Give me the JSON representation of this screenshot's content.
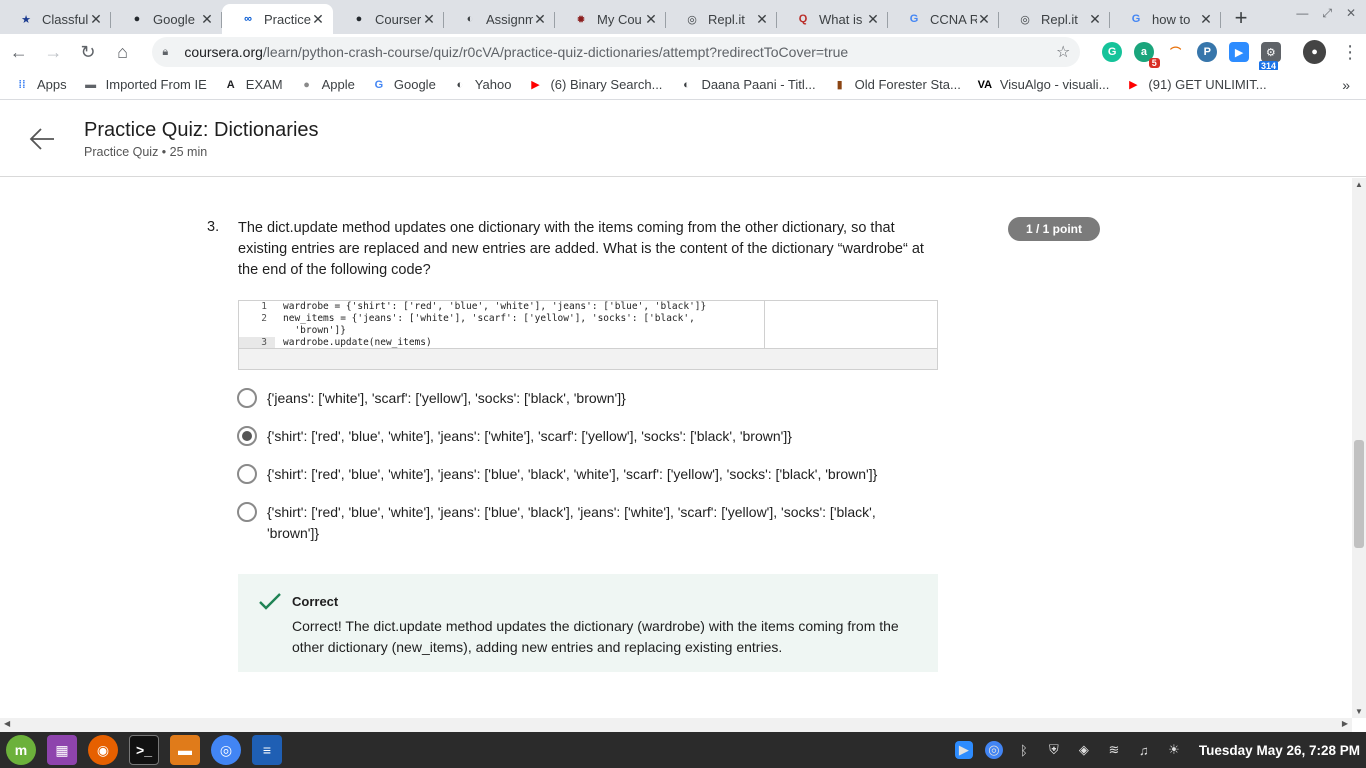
{
  "browser": {
    "tabs": [
      {
        "label": "Classful",
        "icon": "star-shield-icon",
        "color": "#1a3a8f",
        "active": false
      },
      {
        "label": "Google",
        "icon": "github-icon",
        "color": "#24292e",
        "active": false
      },
      {
        "label": "Practice",
        "icon": "coursera-icon",
        "color": "#0056d2",
        "active": true
      },
      {
        "label": "Courser",
        "icon": "github-icon",
        "color": "#24292e",
        "active": false
      },
      {
        "label": "Assignm",
        "icon": "globe-icon",
        "color": "#3c4043",
        "active": false
      },
      {
        "label": "My Cou",
        "icon": "gear-logo-icon",
        "color": "#8b1d1d",
        "active": false
      },
      {
        "label": "Repl.it",
        "icon": "replit-icon",
        "color": "#3c4043",
        "active": false
      },
      {
        "label": "What is",
        "icon": "quora-icon",
        "color": "#b92b27",
        "active": false
      },
      {
        "label": "CCNA R",
        "icon": "google-icon",
        "color": "#4285f4",
        "active": false
      },
      {
        "label": "Repl.it",
        "icon": "replit-icon",
        "color": "#3c4043",
        "active": false
      },
      {
        "label": "how to",
        "icon": "google-icon",
        "color": "#4285f4",
        "active": false
      }
    ],
    "url_domain": "coursera.org",
    "url_path": "/learn/python-crash-course/quiz/r0cVA/practice-quiz-dictionaries/attempt?redirectToCover=true",
    "extensions": {
      "badge_a": "5",
      "badge_b": "314"
    },
    "bookmarks": [
      {
        "label": "Apps",
        "icon": "apps-grid-icon"
      },
      {
        "label": "Imported From IE",
        "icon": "folder-icon"
      },
      {
        "label": "EXAM",
        "icon": "a-logo-icon"
      },
      {
        "label": "Apple",
        "icon": "apple-icon"
      },
      {
        "label": "Google",
        "icon": "google-icon"
      },
      {
        "label": "Yahoo",
        "icon": "globe-icon"
      },
      {
        "label": "(6) Binary Search...",
        "icon": "youtube-icon"
      },
      {
        "label": "Daana Paani - Titl...",
        "icon": "globe-icon"
      },
      {
        "label": "Old Forester Sta...",
        "icon": "bottle-icon"
      },
      {
        "label": "VisuAlgo - visuali...",
        "icon": "visualgo-icon"
      },
      {
        "label": "(91) GET UNLIMIT...",
        "icon": "youtube-icon"
      }
    ]
  },
  "header": {
    "title": "Practice Quiz: Dictionaries",
    "subtitle": "Practice Quiz • 25 min"
  },
  "question": {
    "number": "3.",
    "text": "The dict.update method updates one dictionary with the items coming from the other dictionary, so that existing entries are replaced and new entries are added. What is the content of the dictionary “wardrobe“ at the end of the following code?",
    "points": "1 / 1 point",
    "code": [
      {
        "ln": "1",
        "src": "wardrobe = {'shirt': ['red', 'blue', 'white'], 'jeans': ['blue', 'black']}"
      },
      {
        "ln": "2",
        "src": "new_items = {'jeans': ['white'], 'scarf': ['yellow'], 'socks': ['black',"
      },
      {
        "ln": "",
        "src": "  'brown']}"
      },
      {
        "ln": "3",
        "src": "wardrobe.update(new_items)"
      }
    ],
    "options": [
      {
        "text": "{'jeans': ['white'], 'scarf': ['yellow'], 'socks': ['black', 'brown']}",
        "selected": false
      },
      {
        "text": "{'shirt': ['red', 'blue', 'white'], 'jeans': ['white'], 'scarf': ['yellow'], 'socks': ['black', 'brown']}",
        "selected": true
      },
      {
        "text": "{'shirt': ['red', 'blue', 'white'], 'jeans': ['blue', 'black', 'white'], 'scarf': ['yellow'], 'socks': ['black', 'brown']}",
        "selected": false
      },
      {
        "text": "{'shirt': ['red', 'blue', 'white'], 'jeans': ['blue', 'black'], 'jeans': ['white'], 'scarf': ['yellow'], 'socks': ['black', 'brown']}",
        "selected": false
      }
    ],
    "feedback": {
      "title": "Correct",
      "text": "Correct! The dict.update method updates the dictionary (wardrobe) with the items coming from the other dictionary (new_items), adding new entries and replacing existing entries.",
      "color": "#1f8354"
    }
  },
  "taskbar": {
    "clock": "Tuesday May 26, 7:28 PM"
  }
}
